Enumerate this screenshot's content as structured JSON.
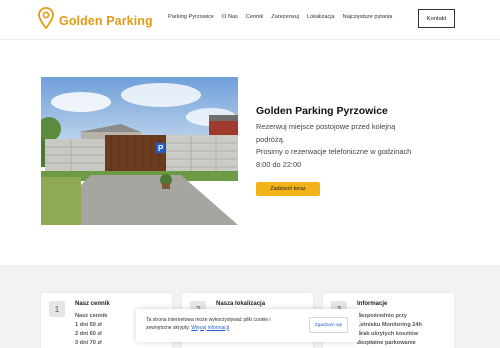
{
  "header": {
    "brand": "Golden Parking",
    "nav": [
      "Parking Pyrzowice",
      "O Nas",
      "Cennik",
      "Zarezerwuj",
      "Lokalizacja",
      "Najczęstsze pytania"
    ],
    "contact_label": "Kontakt"
  },
  "hero": {
    "title": "Golden Parking  Pyrzowice",
    "lines": [
      "Rezerwuj miejsce postojowe przed kolejną",
      "podróżą.",
      "Prosimy o rezerwacje telefoniczne w godzinach",
      "8:00 do 22:00"
    ],
    "call_label": "Zadzwoń teraz"
  },
  "cards": [
    {
      "num": "1",
      "title": "Nasz cennik",
      "lines": [
        "Nasz cennik",
        "1 dni 50 zł",
        "2 dni 60 zł",
        "3 dni 70 zł"
      ]
    },
    {
      "num": "2",
      "title": "Nasza lokalizacja",
      "lines": []
    },
    {
      "num": "3",
      "title": "Informacje",
      "lines": [
        "Bezpośrednio przy",
        "Lotnisku Monitoring 24h",
        "Brak ukrytych kosztów",
        "Bezpłatne parkowanie"
      ]
    }
  ],
  "cookie": {
    "text": "Ta strona internetowa może wykorzystywać pliki cookie i zewnętrzne skrypty.",
    "link": "Więcej informacji",
    "accept": "Zgadzam się"
  },
  "colors": {
    "brand": "#e09a1a",
    "button": "#f2b318",
    "link": "#2a62c9"
  },
  "icons": {
    "logo": "map-pin-icon"
  }
}
